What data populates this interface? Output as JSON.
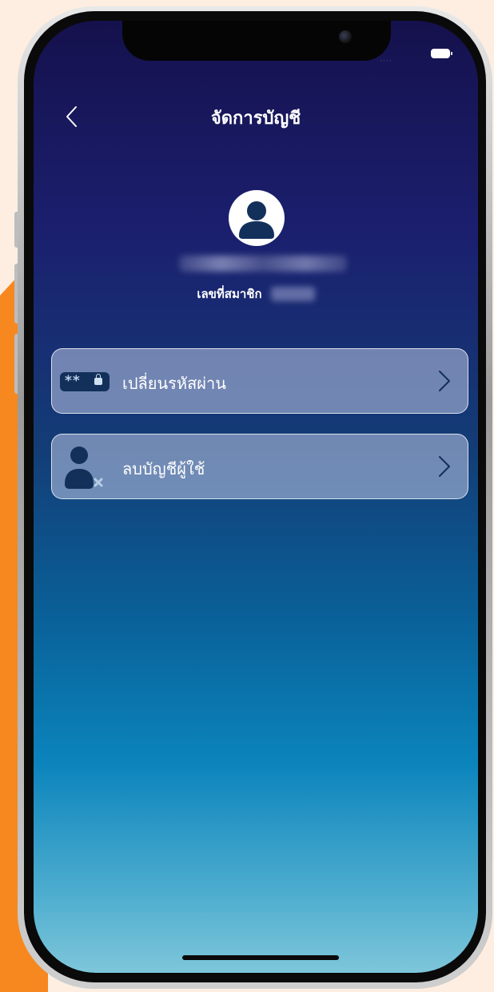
{
  "header": {
    "title": "จัดการบัญชี"
  },
  "status_bar": {
    "signal": "····"
  },
  "profile": {
    "member_label": "เลขที่สมาชิก"
  },
  "menu": {
    "items": [
      {
        "label": "เปลี่ยนรหัสผ่าน",
        "icon": "password-icon",
        "stars": "**"
      },
      {
        "label": "ลบบัญชีผู้ใช้",
        "icon": "delete-user-icon"
      }
    ]
  },
  "colors": {
    "background_top": "#15114d",
    "background_bottom": "#7ec6da",
    "icon_navy": "#12305a",
    "accent_orange": "#f7881f"
  }
}
